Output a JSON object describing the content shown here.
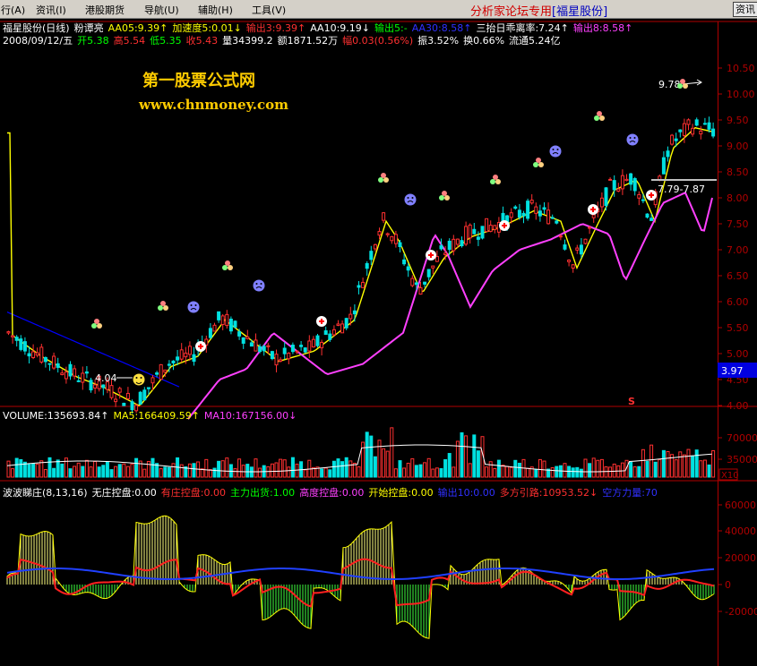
{
  "menubar": {
    "items": [
      "行(A)",
      "资讯(I)",
      "港股期货",
      "导航(U)",
      "辅助(H)",
      "工具(V)"
    ],
    "special_label": "分析家论坛专用",
    "stock_tag": "[福星股份]",
    "right_button": "资讯"
  },
  "price_panel": {
    "header_line1": [
      {
        "text": "福星股份(日线)",
        "color": "#ffffff"
      },
      {
        "text": "粉谭亮",
        "color": "#ffffff"
      },
      {
        "text": "AA05:9.39↑",
        "color": "#ffff00"
      },
      {
        "text": "加速度5:0.01↓",
        "color": "#ffff00"
      },
      {
        "text": "输出3:9.39↑",
        "color": "#ff3030"
      },
      {
        "text": "AA10:9.19↓",
        "color": "#ffffff"
      },
      {
        "text": "输出5:-",
        "color": "#00ff00"
      },
      {
        "text": "AA30:8.58↑",
        "color": "#3030ff"
      },
      {
        "text": "三抬日乖离率:7.24↑",
        "color": "#ffffff"
      },
      {
        "text": "输出8:8.58↑",
        "color": "#ff40ff"
      }
    ],
    "header_line2": [
      {
        "text": "2008/09/12/五",
        "color": "#ffffff"
      },
      {
        "text": "开5.38",
        "color": "#00ff00"
      },
      {
        "text": "高5.54",
        "color": "#ff3030"
      },
      {
        "text": "低5.35",
        "color": "#00ff00"
      },
      {
        "text": "收5.43",
        "color": "#ff3030"
      },
      {
        "text": "量34399.2",
        "color": "#ffffff"
      },
      {
        "text": "额1871.52万",
        "color": "#ffffff"
      },
      {
        "text": "幅0.03(0.56%)",
        "color": "#ff3030"
      },
      {
        "text": "振3.52%",
        "color": "#ffffff"
      },
      {
        "text": "换0.66%",
        "color": "#ffffff"
      },
      {
        "text": "流通5.24亿",
        "color": "#ffffff"
      }
    ],
    "watermark_title": "第一股票公式网",
    "watermark_url": "www.chnmoney.com",
    "y_axis_labels": [
      "10.50",
      "10.00",
      "9.50",
      "9.00",
      "8.50",
      "8.00",
      "7.50",
      "7.00",
      "6.50",
      "6.00",
      "5.50",
      "5.00",
      "4.50",
      "4.00"
    ],
    "current_price_tag": "3.97",
    "annotation_low": "4.04",
    "annotation_high": "9.78",
    "annotation_mid": "7.79-7.87",
    "signal_mark": "S"
  },
  "volume_panel": {
    "header": [
      {
        "text": "VOLUME:135693.84↑",
        "color": "#ffffff"
      },
      {
        "text": "MA5:166409.59↑",
        "color": "#ffff00"
      },
      {
        "text": "MA10:167156.00↓",
        "color": "#ff40ff"
      }
    ],
    "y_axis_labels": [
      "70000",
      "35000"
    ],
    "unit_tag": "X10"
  },
  "indicator_panel": {
    "header": [
      {
        "text": "波波睇庄(8,13,16)",
        "color": "#ffffff"
      },
      {
        "text": "无庄控盘:0.00",
        "color": "#ffffff"
      },
      {
        "text": "有庄控盘:0.00",
        "color": "#ff3030"
      },
      {
        "text": "主力出货:1.00",
        "color": "#00ff00"
      },
      {
        "text": "高度控盘:0.00",
        "color": "#ff40ff"
      },
      {
        "text": "开始控盘:0.00",
        "color": "#ffff00"
      },
      {
        "text": "输出10:0.00",
        "color": "#3030ff"
      },
      {
        "text": "多方引路:10953.52↓",
        "color": "#ff3030"
      },
      {
        "text": "空方力量:70",
        "color": "#3030ff"
      }
    ],
    "y_axis_labels": [
      "60000",
      "40000",
      "20000",
      "0",
      "-20000"
    ]
  },
  "colors": {
    "up": "#ff3030",
    "down": "#00e0e0",
    "ma5": "#ffff00",
    "ma30": "#0000ff",
    "ma_pink": "#ff40ff",
    "axis": "#b00000",
    "grid": "#800000"
  },
  "icons": [
    "smiley-face-icon",
    "sad-face-icon",
    "flower-cluster-icon",
    "buy-cross-icon"
  ]
}
